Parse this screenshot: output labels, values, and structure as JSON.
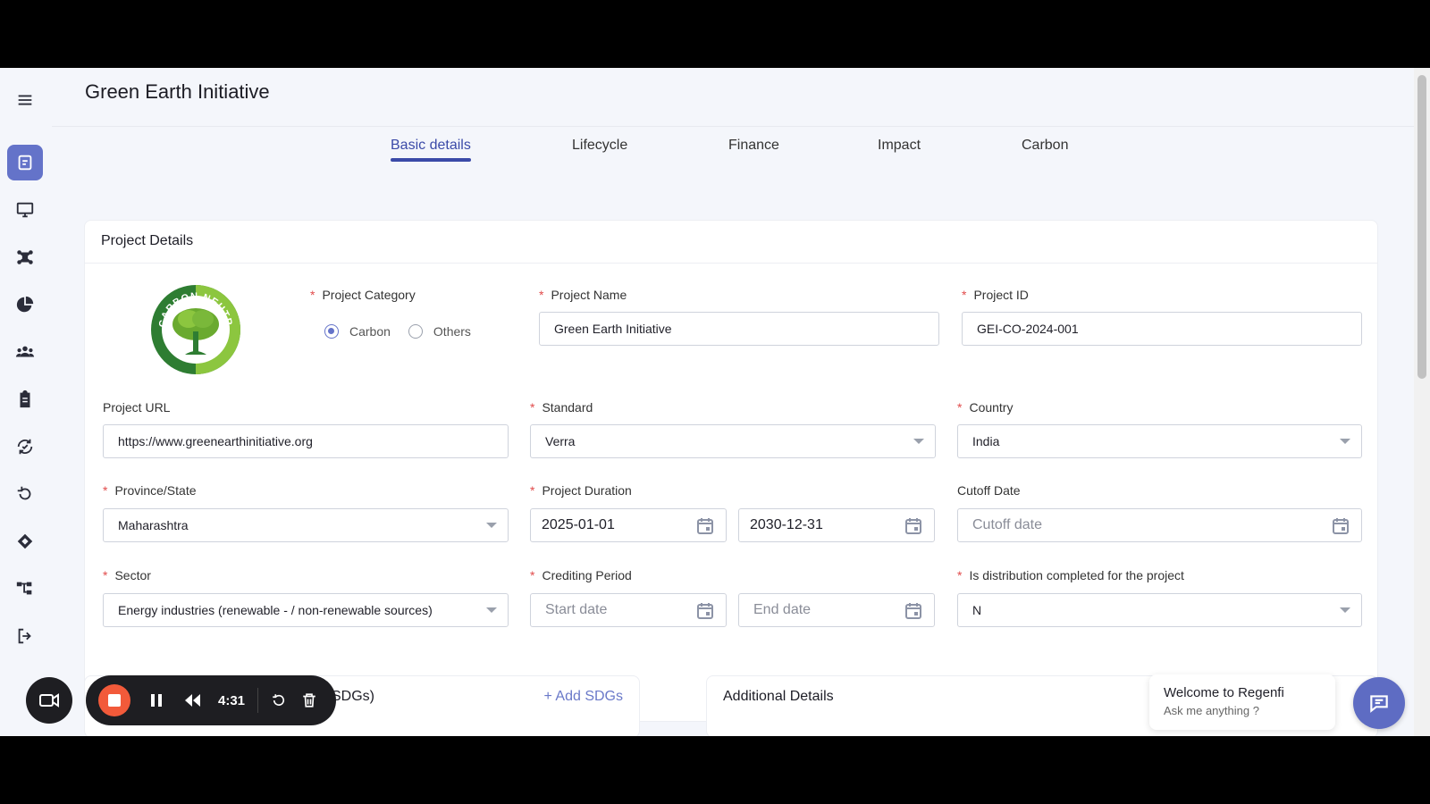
{
  "header": {
    "title": "Green Earth Initiative"
  },
  "tabs": [
    {
      "label": "Basic details",
      "active": true
    },
    {
      "label": "Lifecycle"
    },
    {
      "label": "Finance"
    },
    {
      "label": "Impact"
    },
    {
      "label": "Carbon"
    }
  ],
  "sidebar": {
    "icons": [
      "menu-icon",
      "document-icon",
      "monitor-icon",
      "network-icon",
      "pie-chart-icon",
      "users-icon",
      "clipboard-icon",
      "cycle-icon",
      "refresh-icon",
      "handshake-icon",
      "hierarchy-icon",
      "logout-icon"
    ]
  },
  "project_details": {
    "title": "Project Details",
    "logo_text": "CARBON NEUTRAL",
    "project_category": {
      "label": "Project Category",
      "options": [
        "Carbon",
        "Others"
      ],
      "selected": "Carbon"
    },
    "project_name": {
      "label": "Project Name",
      "value": "Green Earth Initiative"
    },
    "project_id": {
      "label": "Project ID",
      "value": "GEI-CO-2024-001"
    },
    "project_url": {
      "label": "Project URL",
      "value": "https://www.greenearthinitiative.org"
    },
    "standard": {
      "label": "Standard",
      "value": "Verra"
    },
    "country": {
      "label": "Country",
      "value": "India"
    },
    "province": {
      "label": "Province/State",
      "value": "Maharashtra"
    },
    "project_duration": {
      "label": "Project Duration",
      "start": "2025-01-01",
      "end": "2030-12-31"
    },
    "cutoff_date": {
      "label": "Cutoff Date",
      "placeholder": "Cutoff date"
    },
    "sector": {
      "label": "Sector",
      "value": "Energy industries (renewable - / non-renewable sources)"
    },
    "crediting_period": {
      "label": "Crediting Period",
      "start_placeholder": "Start date",
      "end_placeholder": "End date"
    },
    "distribution": {
      "label": "Is distribution completed for the project",
      "value": "N"
    }
  },
  "sdg": {
    "title_partial": "SDGs)",
    "add_label": "+ Add SDGs"
  },
  "additional": {
    "title": "Additional Details"
  },
  "chat": {
    "welcome": "Welcome to Regenfi",
    "prompt": "Ask me anything ?"
  },
  "recorder": {
    "time": "4:31"
  },
  "colors": {
    "accent": "#6473c9",
    "tab_active": "#3b4aa8",
    "required": "#e14b4b",
    "record": "#f25a3a"
  }
}
